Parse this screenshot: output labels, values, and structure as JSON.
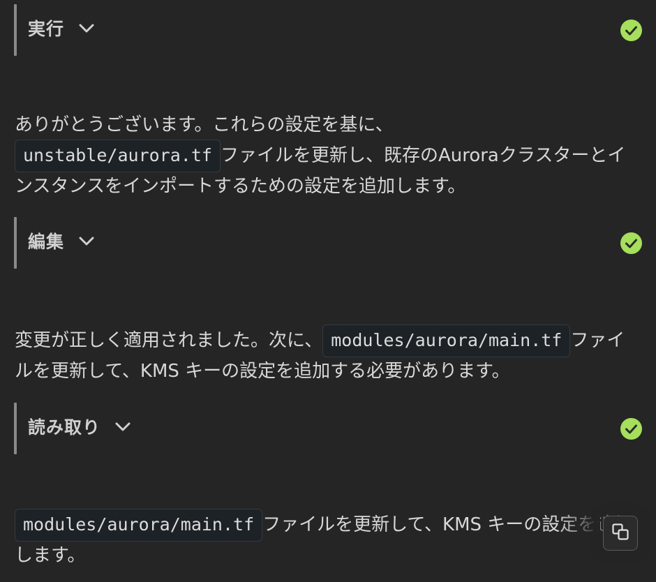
{
  "steps": [
    {
      "title": "実行",
      "status": "done"
    },
    {
      "title": "編集",
      "status": "done"
    },
    {
      "title": "読み取り",
      "status": "done"
    }
  ],
  "messages": {
    "m1": {
      "text1": "ありがとうございます。これらの設定を基に、",
      "code": "unstable/aurora.tf",
      "text2": "ファイルを更新し、既存のAuroraクラスターとインスタンスをインポートするための設定を追加します。"
    },
    "m2": {
      "text1": "変更が正しく適用されました。次に、",
      "code": "modules/aurora/main.tf",
      "text2": "ファイルを更新して、KMS キーの設定を追加する必要があります。"
    },
    "m3": {
      "code": "modules/aurora/main.tf",
      "text2": "ファイルを更新して、KMS キーの設定を追加します。"
    }
  },
  "colors": {
    "background": "#252526",
    "check": "#a6df5c",
    "step_bar": "#8a8a8a"
  },
  "icons": {
    "expand": "chevron-down-icon",
    "status": "check-circle-icon",
    "copy": "copy-icon"
  }
}
